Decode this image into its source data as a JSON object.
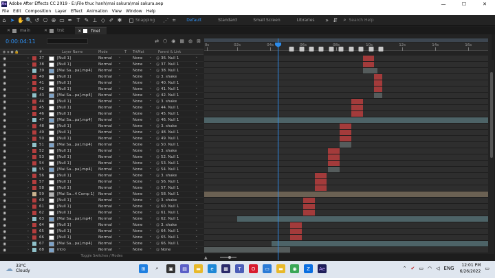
{
  "window": {
    "title": "Adobe After Effects CC 2019 - E:\\File thuc hanh\\mai sakura\\mai sakura.aep",
    "app_badge": "Ae",
    "min": "—",
    "max": "☐",
    "close": "✕"
  },
  "menu": [
    "File",
    "Edit",
    "Composition",
    "Layer",
    "Effect",
    "Animation",
    "View",
    "Window",
    "Help"
  ],
  "toolbar": {
    "snapping_label": "Snapping",
    "workspaces": [
      "Default",
      "Standard",
      "Small Screen",
      "Libraries"
    ],
    "search_placeholder": "Search Help"
  },
  "tabs": [
    {
      "label": "main",
      "color": "#8e8e8e"
    },
    {
      "label": "trst",
      "color": "#8e8e8e"
    },
    {
      "label": "finel",
      "color": "#ffffff"
    }
  ],
  "timecode": "0:00:04:11",
  "columns": {
    "layer_name": "Layer Name",
    "mode": "Mode",
    "t": "T",
    "trkmat": "TrkMat",
    "parent": "Parent & Link"
  },
  "toggle_label": "Toggle Switches / Modes",
  "ruler": {
    "ticks": [
      "0s",
      "02s",
      "04s",
      "06s",
      "08s",
      "10s",
      "12s",
      "14s",
      "16s"
    ],
    "start": 0,
    "end": 17.2
  },
  "playhead_time": 4.46,
  "layers": [
    {
      "num": "37",
      "color": "#b33e3e",
      "src": "solid",
      "name": "[Null 1]",
      "mode": "Normal",
      "trkmat": "None",
      "parent": "36. Null 1",
      "bar": [
        9.6,
        10.3
      ],
      "barColor": "red"
    },
    {
      "num": "38",
      "color": "#b33e3e",
      "src": "solid",
      "name": "[Null 1]",
      "mode": "Normal",
      "trkmat": "None",
      "parent": "37. Null 1",
      "bar": [
        9.6,
        10.3
      ],
      "barColor": "red"
    },
    {
      "num": "39",
      "color": "#8fc1c9",
      "src": "vid",
      "name": "[Mai Sa...pa].mp4]",
      "mode": "Normal",
      "trkmat": "None",
      "parent": "38. Null 1",
      "bar": [
        9.6,
        10.5
      ],
      "barColor": "gray"
    },
    {
      "num": "40",
      "color": "#b33e3e",
      "src": "solid",
      "name": "[Null 1]",
      "mode": "Normal",
      "trkmat": "None",
      "parent": "3. shake",
      "bar": [
        10.3,
        10.8
      ],
      "barColor": "red"
    },
    {
      "num": "41",
      "color": "#b33e3e",
      "src": "solid",
      "name": "[Null 1]",
      "mode": "Normal",
      "trkmat": "None",
      "parent": "40. Null 1",
      "bar": [
        10.3,
        10.8
      ],
      "barColor": "red"
    },
    {
      "num": "42",
      "color": "#b33e3e",
      "src": "solid",
      "name": "[Null 1]",
      "mode": "Normal",
      "trkmat": "None",
      "parent": "41. Null 1",
      "bar": [
        10.3,
        10.8
      ],
      "barColor": "red"
    },
    {
      "num": "43",
      "color": "#8fc1c9",
      "src": "vid",
      "name": "[Mai Sa...pa].mp4]",
      "mode": "Normal",
      "trkmat": "None",
      "parent": "42. Null 1",
      "bar": [
        10.3,
        10.8
      ],
      "barColor": "gray"
    },
    {
      "num": "44",
      "color": "#b33e3e",
      "src": "solid",
      "name": "[Null 1]",
      "mode": "Normal",
      "trkmat": "None",
      "parent": "3. shake",
      "bar": [
        8.9,
        9.6
      ],
      "barColor": "red"
    },
    {
      "num": "45",
      "color": "#b33e3e",
      "src": "solid",
      "name": "[Null 1]",
      "mode": "Normal",
      "trkmat": "None",
      "parent": "44. Null 1",
      "bar": [
        8.9,
        9.6
      ],
      "barColor": "red"
    },
    {
      "num": "46",
      "color": "#b33e3e",
      "src": "solid",
      "name": "[Null 1]",
      "mode": "Normal",
      "trkmat": "None",
      "parent": "45. Null 1",
      "bar": [
        8.9,
        9.6
      ],
      "barColor": "red"
    },
    {
      "num": "47",
      "color": "#8fc1c9",
      "src": "vid",
      "name": "[Mai Sa...pa].mp4]",
      "mode": "Normal",
      "trkmat": "None",
      "parent": "46. Null 1",
      "bar": [
        0,
        17.2
      ],
      "barColor": "vid"
    },
    {
      "num": "48",
      "color": "#b33e3e",
      "src": "solid",
      "name": "[Null 1]",
      "mode": "Normal",
      "trkmat": "None",
      "parent": "3. shake",
      "bar": [
        8.2,
        8.9
      ],
      "barColor": "red"
    },
    {
      "num": "49",
      "color": "#b33e3e",
      "src": "solid",
      "name": "[Null 1]",
      "mode": "Normal",
      "trkmat": "None",
      "parent": "48. Null 1",
      "bar": [
        8.2,
        8.9
      ],
      "barColor": "red"
    },
    {
      "num": "50",
      "color": "#b33e3e",
      "src": "solid",
      "name": "[Null 1]",
      "mode": "Normal",
      "trkmat": "None",
      "parent": "49. Null 1",
      "bar": [
        8.2,
        8.9
      ],
      "barColor": "red"
    },
    {
      "num": "51",
      "color": "#8fc1c9",
      "src": "vid",
      "name": "[Mai Sa...pa].mp4]",
      "mode": "Normal",
      "trkmat": "None",
      "parent": "50. Null 1",
      "bar": [
        8.2,
        8.9
      ],
      "barColor": "gray"
    },
    {
      "num": "52",
      "color": "#b33e3e",
      "src": "solid",
      "name": "[Null 1]",
      "mode": "Normal",
      "trkmat": "None",
      "parent": "3. shake",
      "bar": [
        7.5,
        8.2
      ],
      "barColor": "red"
    },
    {
      "num": "53",
      "color": "#b33e3e",
      "src": "solid",
      "name": "[Null 1]",
      "mode": "Normal",
      "trkmat": "None",
      "parent": "52. Null 1",
      "bar": [
        7.5,
        8.2
      ],
      "barColor": "red"
    },
    {
      "num": "54",
      "color": "#b33e3e",
      "src": "solid",
      "name": "[Null 1]",
      "mode": "Normal",
      "trkmat": "None",
      "parent": "53. Null 1",
      "bar": [
        7.5,
        8.2
      ],
      "barColor": "red"
    },
    {
      "num": "55",
      "color": "#8fc1c9",
      "src": "vid",
      "name": "[Mai Sa...pa].mp4]",
      "mode": "Normal",
      "trkmat": "None",
      "parent": "54. Null 1",
      "bar": [
        7.5,
        8.2
      ],
      "barColor": "gray"
    },
    {
      "num": "56",
      "color": "#b33e3e",
      "src": "solid",
      "name": "[Null 1]",
      "mode": "Normal",
      "trkmat": "None",
      "parent": "3. shake",
      "bar": [
        6.7,
        7.4
      ],
      "barColor": "red"
    },
    {
      "num": "57",
      "color": "#b33e3e",
      "src": "solid",
      "name": "[Null 1]",
      "mode": "Normal",
      "trkmat": "None",
      "parent": "56. Null 1",
      "bar": [
        6.7,
        7.4
      ],
      "barColor": "red"
    },
    {
      "num": "58",
      "color": "#b33e3e",
      "src": "solid",
      "name": "[Null 1]",
      "mode": "Normal",
      "trkmat": "None",
      "parent": "57. Null 1",
      "bar": [
        6.7,
        7.4
      ],
      "barColor": "red"
    },
    {
      "num": "59",
      "color": "#c9b28f",
      "src": "comp",
      "name": "[Mai Sa...4 Comp 1]",
      "mode": "Normal",
      "trkmat": "None",
      "parent": "58. Null 1",
      "bar": [
        0,
        17.2
      ],
      "barColor": "comp"
    },
    {
      "num": "60",
      "color": "#b33e3e",
      "src": "solid",
      "name": "[Null 1]",
      "mode": "Normal",
      "trkmat": "None",
      "parent": "3. shake",
      "bar": [
        6.0,
        6.7
      ],
      "barColor": "red"
    },
    {
      "num": "61",
      "color": "#b33e3e",
      "src": "solid",
      "name": "[Null 1]",
      "mode": "Normal",
      "trkmat": "None",
      "parent": "60. Null 1",
      "bar": [
        6.0,
        6.7
      ],
      "barColor": "red"
    },
    {
      "num": "62",
      "color": "#b33e3e",
      "src": "solid",
      "name": "[Null 1]",
      "mode": "Normal",
      "trkmat": "None",
      "parent": "61. Null 1",
      "bar": [
        6.0,
        6.7
      ],
      "barColor": "red"
    },
    {
      "num": "63",
      "color": "#8fc1c9",
      "src": "vid",
      "name": "[Mai Sa...pa].mp4]",
      "mode": "Normal",
      "trkmat": "None",
      "parent": "62. Null 1",
      "bar": [
        2.0,
        17.2
      ],
      "barColor": "vid"
    },
    {
      "num": "64",
      "color": "#b33e3e",
      "src": "solid",
      "name": "[Null 1]",
      "mode": "Normal",
      "trkmat": "None",
      "parent": "3. shake",
      "bar": [
        5.2,
        5.9
      ],
      "barColor": "red"
    },
    {
      "num": "65",
      "color": "#b33e3e",
      "src": "solid",
      "name": "[Null 1]",
      "mode": "Normal",
      "trkmat": "None",
      "parent": "64. Null 1",
      "bar": [
        5.2,
        5.9
      ],
      "barColor": "red"
    },
    {
      "num": "66",
      "color": "#b33e3e",
      "src": "solid",
      "name": "[Null 1]",
      "mode": "Normal",
      "trkmat": "None",
      "parent": "65. Null 1",
      "bar": [
        5.2,
        5.9
      ],
      "barColor": "red"
    },
    {
      "num": "67",
      "color": "#8fc1c9",
      "src": "vid",
      "name": "[Mai Sa...pa].mp4]",
      "mode": "Normal",
      "trkmat": "None",
      "parent": "66. Null 1",
      "bar": [
        4.1,
        17.2
      ],
      "barColor": "vid"
    },
    {
      "num": "68",
      "color": "#8fc1c9",
      "src": "vid",
      "name": "intro",
      "mode": "Normal",
      "trkmat": "None",
      "parent": "None",
      "bar": [
        0,
        5.2
      ],
      "barColor": "gray"
    }
  ],
  "markers": [
    5.3,
    5.9,
    6.5,
    7.1,
    7.7,
    8.3,
    8.9,
    9.5,
    10.1,
    10.7
  ],
  "taskbar": {
    "temp": "33°C",
    "condition": "Cloudy",
    "lang": "ENG",
    "time": "12:01 PM",
    "date": "6/26/2022"
  }
}
